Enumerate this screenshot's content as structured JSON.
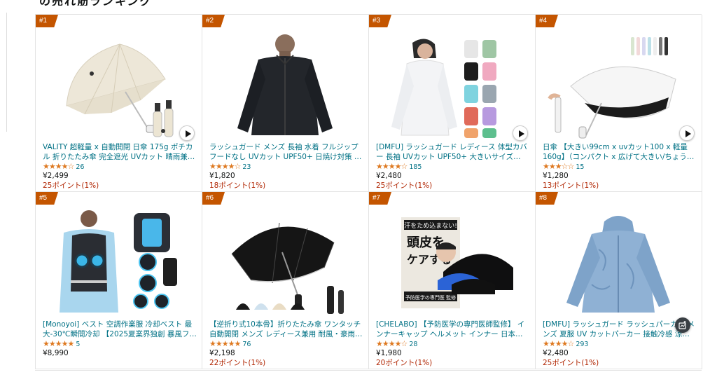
{
  "section_heading": "の売れ筋ランキング",
  "colors": {
    "link": "#007185",
    "rank_badge": "#c45500",
    "star": "#de7921",
    "points": "#b12704"
  },
  "products": [
    {
      "rank": "#1",
      "title": "VALITY 超軽量 x 自動開閉 日傘 175g ポチカル 折りたたみ傘 完全遮光 UVカット 晴雨兼…",
      "stars": "★★★★☆",
      "rating_count": "26",
      "price": "¥2,499",
      "points": "25ポイント(1%)",
      "image": "umbrella-beige",
      "has_video": true
    },
    {
      "rank": "#2",
      "title": "ラッシュガード メンズ 長袖 水着 フルジップ フードなし UVカット UPF50+ 日焼け対策 …",
      "stars": "★★★★☆",
      "rating_count": "23",
      "price": "¥1,820",
      "points": "18ポイント(1%)",
      "image": "rashguard-black",
      "has_video": false
    },
    {
      "rank": "#3",
      "title": "[DMFU] ラッシュガード レディース 体型カバー 長袖 UVカット UPF50+ 大きいサイズ パ…",
      "stars": "★★★★☆",
      "rating_count": "185",
      "price": "¥2,480",
      "points": "25ポイント(1%)",
      "image": "rashguard-women",
      "has_video": true
    },
    {
      "rank": "#4",
      "title": "日傘 【大きい99cm x uvカット100 x 軽量160g】（コンパクト x 広げて大きい/ちょう…",
      "stars": "★★★☆☆",
      "rating_count": "15",
      "price": "¥1,280",
      "points": "13ポイント(1%)",
      "image": "umbrella-white",
      "has_video": true
    },
    {
      "rank": "#5",
      "title": "[Monoyoi] ベスト 空調作業服 冷却ベスト 最大-30℃瞬間冷却 【2025夏業界独創 暴風ファン+アイスパック】 冷却服 ファン付きベス…",
      "stars": "★★★★★",
      "rating_count": "5",
      "price": "¥8,990",
      "points": "",
      "image": "cooling-vest",
      "has_video": false
    },
    {
      "rank": "#6",
      "title": "【逆折り式10本骨】折りたたみ傘 ワンタッチ自動開閉 メンズ レディース兼用 耐風・豪雨…",
      "stars": "★★★★★",
      "rating_count": "76",
      "price": "¥2,198",
      "points": "22ポイント(1%)",
      "image": "umbrella-black",
      "has_video": false
    },
    {
      "rank": "#7",
      "title": "[CHELABO] 【予防医学の専門医師監修】 インナーキャップ ヘルメット インナー 日本製 U…",
      "stars": "★★★★☆",
      "rating_count": "28",
      "price": "¥1,980",
      "points": "20ポイント(1%)",
      "image": "inner-cap",
      "has_video": false
    },
    {
      "rank": "#8",
      "title": "[DMFU] ラッシュガード ラッシュパーカー メンズ 夏服 UV カットパーカー 接触冷感 涼し…",
      "stars": "★★★★☆",
      "rating_count": "293",
      "price": "¥2,480",
      "points": "25ポイント(1%)",
      "image": "hoodie-blue",
      "has_video": false
    }
  ],
  "product_images": {
    "inner_cap": {
      "badge": "汗をため込まない!",
      "headline_1": "頭皮を",
      "headline_2": "ケアする",
      "footer": "予防医学の専門医 監修"
    }
  }
}
